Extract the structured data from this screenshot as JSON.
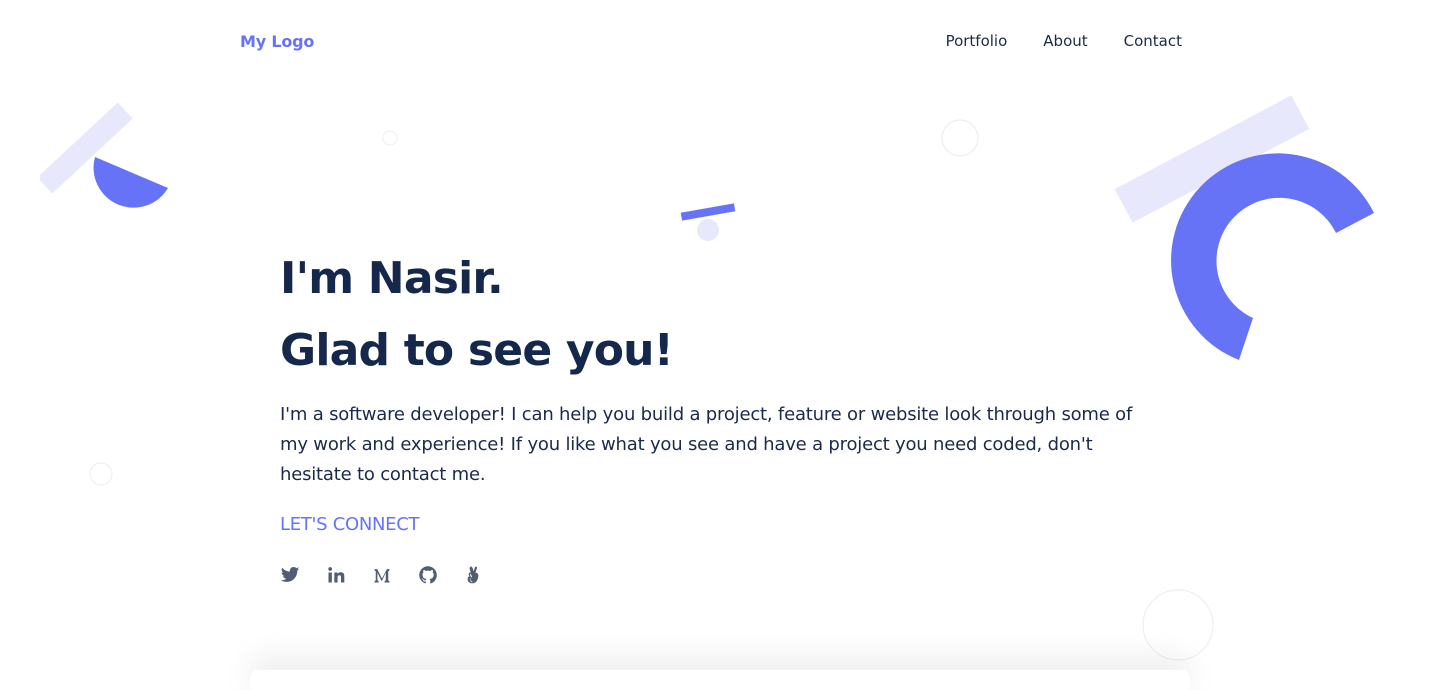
{
  "header": {
    "logo": "My Logo",
    "nav": [
      "Portfolio",
      "About",
      "Contact"
    ]
  },
  "hero": {
    "line1": "I'm Nasir.",
    "line2": "Glad to see you!",
    "description": "I'm a software developer! I can help you build a project, feature or website look through some of my work and experience! If you like what you see and have a project you need coded, don't hesitate to contact me.",
    "cta": "LET'S CONNECT"
  },
  "social": [
    "twitter-icon",
    "linkedin-icon",
    "medium-icon",
    "github-icon",
    "angellist-icon"
  ],
  "colors": {
    "accent": "#6673f7",
    "accent_light": "#e8e8fd",
    "heading": "#15284b",
    "text": "#1b2a4a",
    "icon": "#525d73"
  }
}
